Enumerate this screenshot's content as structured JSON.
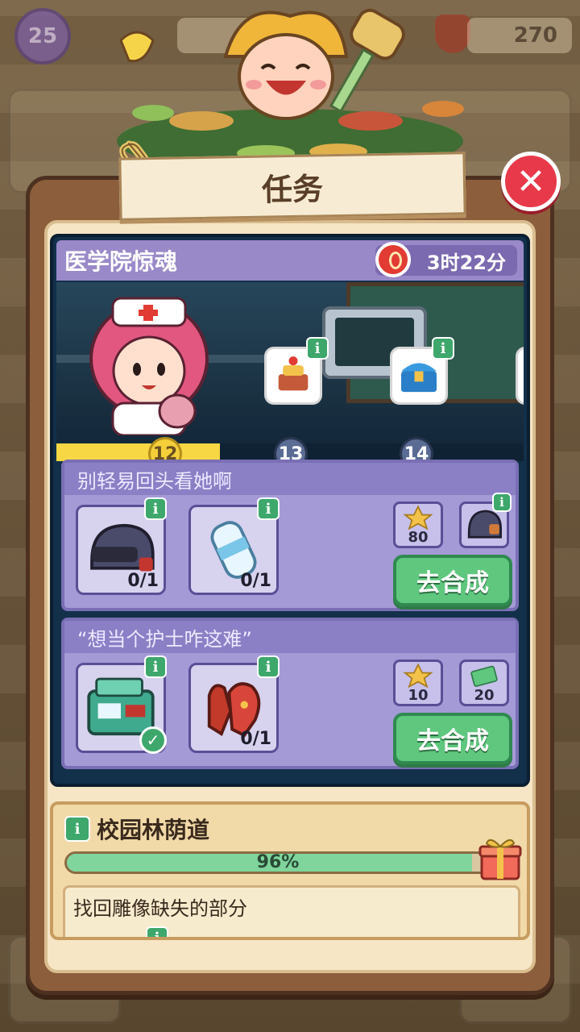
{
  "hud": {
    "level": "25",
    "currency": "270"
  },
  "dialog": {
    "title": "任务",
    "close_symbol": "✕"
  },
  "chapter": {
    "name": "医学院惊魂",
    "timer": "3时22分",
    "progress_fraction": 0.35,
    "milestones": [
      {
        "label": "12",
        "reached": true
      },
      {
        "label": "13",
        "reached": false
      },
      {
        "label": "14",
        "reached": false
      }
    ]
  },
  "tasks": [
    {
      "title": "别轻易回头看她啊",
      "items": [
        {
          "icon": "helmet-icon",
          "count": "0/1",
          "done": false
        },
        {
          "icon": "water-bottle-icon",
          "count": "0/1",
          "done": false
        }
      ],
      "rewards": [
        {
          "icon": "star-coin-icon",
          "value": "80"
        },
        {
          "icon": "helmet-icon",
          "value": ""
        }
      ],
      "button": "去合成"
    },
    {
      "title": "“想当个护士咋这难”",
      "items": [
        {
          "icon": "first-aid-kit-icon",
          "count": "",
          "done": true
        },
        {
          "icon": "gloves-icon",
          "count": "0/1",
          "done": false
        }
      ],
      "rewards": [
        {
          "icon": "star-coin-icon",
          "value": "10"
        },
        {
          "icon": "cash-icon",
          "value": "20"
        }
      ],
      "button": "去合成"
    }
  ],
  "chapter2": {
    "name": "校园林荫道",
    "progress": "96%",
    "progress_fraction": 0.96,
    "subtask": "找回雕像缺失的部分"
  },
  "info_symbol": "i",
  "check_symbol": "✓",
  "colors": {
    "accent_green": "#5fc77e",
    "close_red": "#e8394a",
    "progress_yellow": "#f7d743",
    "chapter_purple": "#9a89c9"
  }
}
